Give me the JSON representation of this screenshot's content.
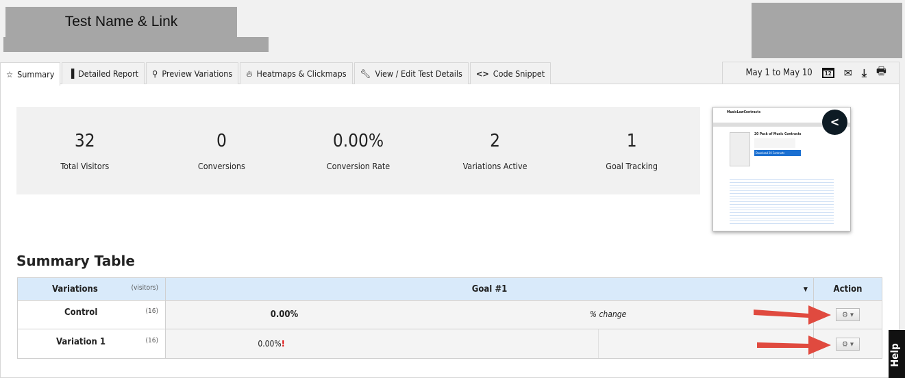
{
  "header": {
    "title": "Test Name & Link"
  },
  "tabs": [
    {
      "label": "Summary",
      "icon": "star-icon"
    },
    {
      "label": "Detailed Report",
      "icon": "bar-chart-icon"
    },
    {
      "label": "Preview Variations",
      "icon": "search-icon"
    },
    {
      "label": "Heatmaps & Clickmaps",
      "icon": "fire-icon"
    },
    {
      "label": "View / Edit Test Details",
      "icon": "wrench-icon"
    },
    {
      "label": "Code Snippet",
      "icon": "code-icon"
    }
  ],
  "toolbar": {
    "date_range": "May 1 to May 10",
    "calendar_day": "12"
  },
  "stats": [
    {
      "value": "32",
      "label": "Total Visitors"
    },
    {
      "value": "0",
      "label": "Conversions"
    },
    {
      "value": "0.00%",
      "label": "Conversion Rate"
    },
    {
      "value": "2",
      "label": "Variations Active"
    },
    {
      "value": "1",
      "label": "Goal Tracking"
    }
  ],
  "thumbnail": {
    "site": "MusicLawContracts",
    "heading": "20 Pack of Music Contracts",
    "button": "Download 20 Contracts"
  },
  "summary": {
    "title": "Summary Table",
    "headers": {
      "variations": "Variations",
      "visitors": "(visitors)",
      "goal": "Goal #1",
      "action": "Action"
    },
    "rows": [
      {
        "name": "Control",
        "visitors": "(16)",
        "rate": "0.00%",
        "change": "% change"
      },
      {
        "name": "Variation 1",
        "visitors": "(16)",
        "rate": "0.00%",
        "change": ""
      }
    ]
  },
  "help": {
    "label": "Help"
  },
  "colors": {
    "accent_arrow": "#e04a3f",
    "header_bg": "#d9eafa"
  }
}
